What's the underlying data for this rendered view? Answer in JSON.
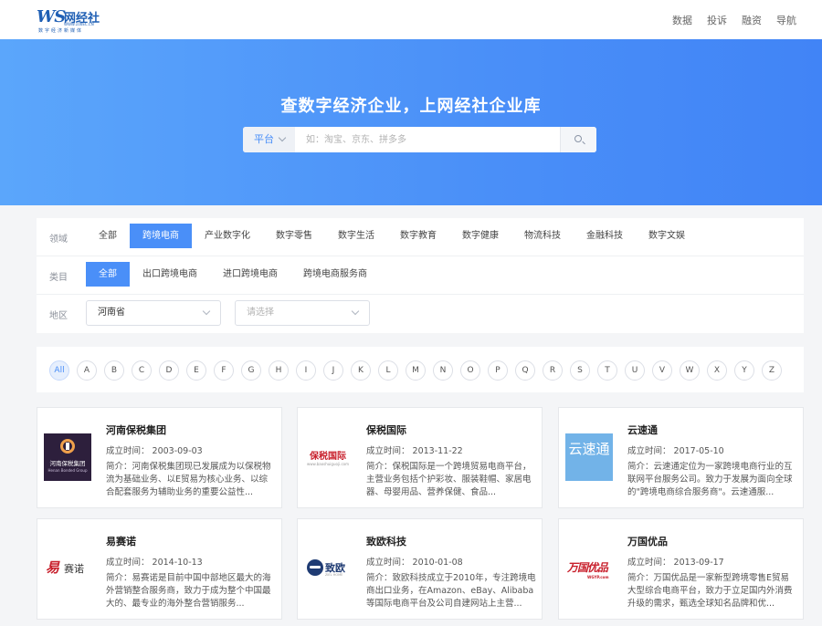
{
  "header": {
    "logo": {
      "ws": "WS",
      "cn": "网经社",
      "url": "WWW.100EC.CN",
      "sub": "数字经济新媒体"
    },
    "nav": [
      "数据",
      "投诉",
      "融资",
      "导航"
    ]
  },
  "hero": {
    "title": "查数字经济企业，上网经社企业库",
    "search": {
      "select": "平台",
      "placeholder": "如：淘宝、京东、拼多多"
    }
  },
  "filters": {
    "domain": {
      "label": "领域",
      "options": [
        "全部",
        "跨境电商",
        "产业数字化",
        "数字零售",
        "数字生活",
        "数字教育",
        "数字健康",
        "物流科技",
        "金融科技",
        "数字文娱"
      ],
      "active": 1
    },
    "category": {
      "label": "类目",
      "options": [
        "全部",
        "出口跨境电商",
        "进口跨境电商",
        "跨境电商服务商"
      ],
      "active": 0
    },
    "region": {
      "label": "地区",
      "province": "河南省",
      "city_placeholder": "请选择"
    }
  },
  "alphabet": [
    "All",
    "A",
    "B",
    "C",
    "D",
    "E",
    "F",
    "G",
    "H",
    "I",
    "J",
    "K",
    "L",
    "M",
    "N",
    "O",
    "P",
    "Q",
    "R",
    "S",
    "T",
    "U",
    "V",
    "W",
    "X",
    "Y",
    "Z"
  ],
  "cards": [
    {
      "name": "河南保税集团",
      "date": "成立时间： 2003-09-03",
      "desc": "简介：河南保税集团现已发展成为以保税物流为基础业务、以E贸易为核心业务、以综合配套服务为辅助业务的重要公益性...",
      "logo": [
        "河南保税集团",
        "Henan Bonded Group"
      ]
    },
    {
      "name": "保税国际",
      "date": "成立时间： 2013-11-22",
      "desc": "简介：保税国际是一个跨境贸易电商平台，主营业务包括个护彩妆、服装鞋帽、家居电器、母婴用品、营养保健、食品...",
      "logo": [
        "保税国际",
        "www.baoshuiguoji.com"
      ]
    },
    {
      "name": "云速通",
      "date": "成立时间： 2017-05-10",
      "desc": "简介：云速通定位为一家跨境电商行业的互联网平台服务公司。致力于发展为面向全球的\"跨境电商综合服务商\"。云速通服...",
      "logo": [
        "云速通"
      ]
    },
    {
      "name": "易赛诺",
      "date": "成立时间： 2014-10-13",
      "desc": "简介：易赛诺是目前中国中部地区最大的海外营销整合服务商，致力于成为整个中国最大的、最专业的海外整合营销服务...",
      "logo": [
        "易",
        "赛诺"
      ]
    },
    {
      "name": "致欧科技",
      "date": "成立时间： 2010-01-08",
      "desc": "简介：致欧科技成立于2010年，专注跨境电商出口业务，在Amazon、eBay、Alibaba等国际电商平台及公司自建网站上主营...",
      "logo": [
        "致欧",
        "ZIEL HOME"
      ]
    },
    {
      "name": "万国优品",
      "date": "成立时间： 2013-09-17",
      "desc": "简介：万国优品是一家新型跨境零售E贸易大型综合电商平台，致力于立足国内外消费升级的需求，甄选全球知名品牌和优...",
      "logo": [
        "万国优品",
        "WGYP.com"
      ]
    }
  ],
  "colors": {
    "accent": "#4a8ff8",
    "hero_start": "#5ba6fb",
    "hero_end": "#4184f6"
  }
}
